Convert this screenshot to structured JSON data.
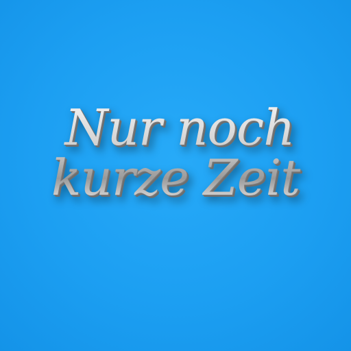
{
  "headline": {
    "line1": "Nur noch",
    "line2": "kurze Zeit"
  },
  "colors": {
    "background": "#1c9ff2",
    "text_metal": "#d2d2d2"
  }
}
